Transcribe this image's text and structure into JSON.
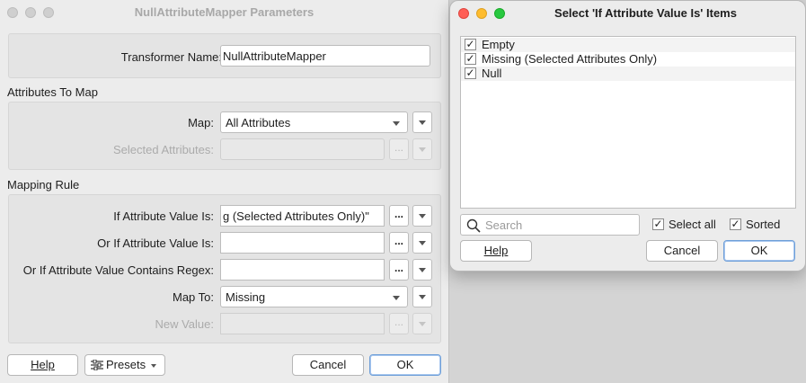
{
  "main": {
    "title": "NullAttributeMapper Parameters",
    "transformer_name_label": "Transformer Name:",
    "transformer_name_value": "NullAttributeMapper",
    "attributes_section": "Attributes To Map",
    "map_label": "Map:",
    "map_value": "All Attributes",
    "selected_attrs_label": "Selected Attributes:",
    "mapping_section": "Mapping Rule",
    "if_value_label": "If Attribute Value Is:",
    "if_value_value": "g (Selected Attributes Only)\"",
    "or_if_label": "Or If Attribute Value Is:",
    "or_if_regex_label": "Or If Attribute Value Contains Regex:",
    "map_to_label": "Map To:",
    "map_to_value": "Missing",
    "new_value_label": "New Value:",
    "ellipsis": "...",
    "help_label": "Help",
    "presets_label": "Presets",
    "cancel_label": "Cancel",
    "ok_label": "OK"
  },
  "select_dialog": {
    "title": "Select 'If Attribute Value Is' Items",
    "items": [
      {
        "label": "Empty",
        "checked": true
      },
      {
        "label": "Missing (Selected Attributes Only)",
        "checked": true
      },
      {
        "label": "Null",
        "checked": true
      }
    ],
    "search_placeholder": "Search",
    "select_all_label": "Select all",
    "sorted_label": "Sorted",
    "help_label": "Help",
    "cancel_label": "Cancel",
    "ok_label": "OK",
    "check_glyph": "✓"
  }
}
